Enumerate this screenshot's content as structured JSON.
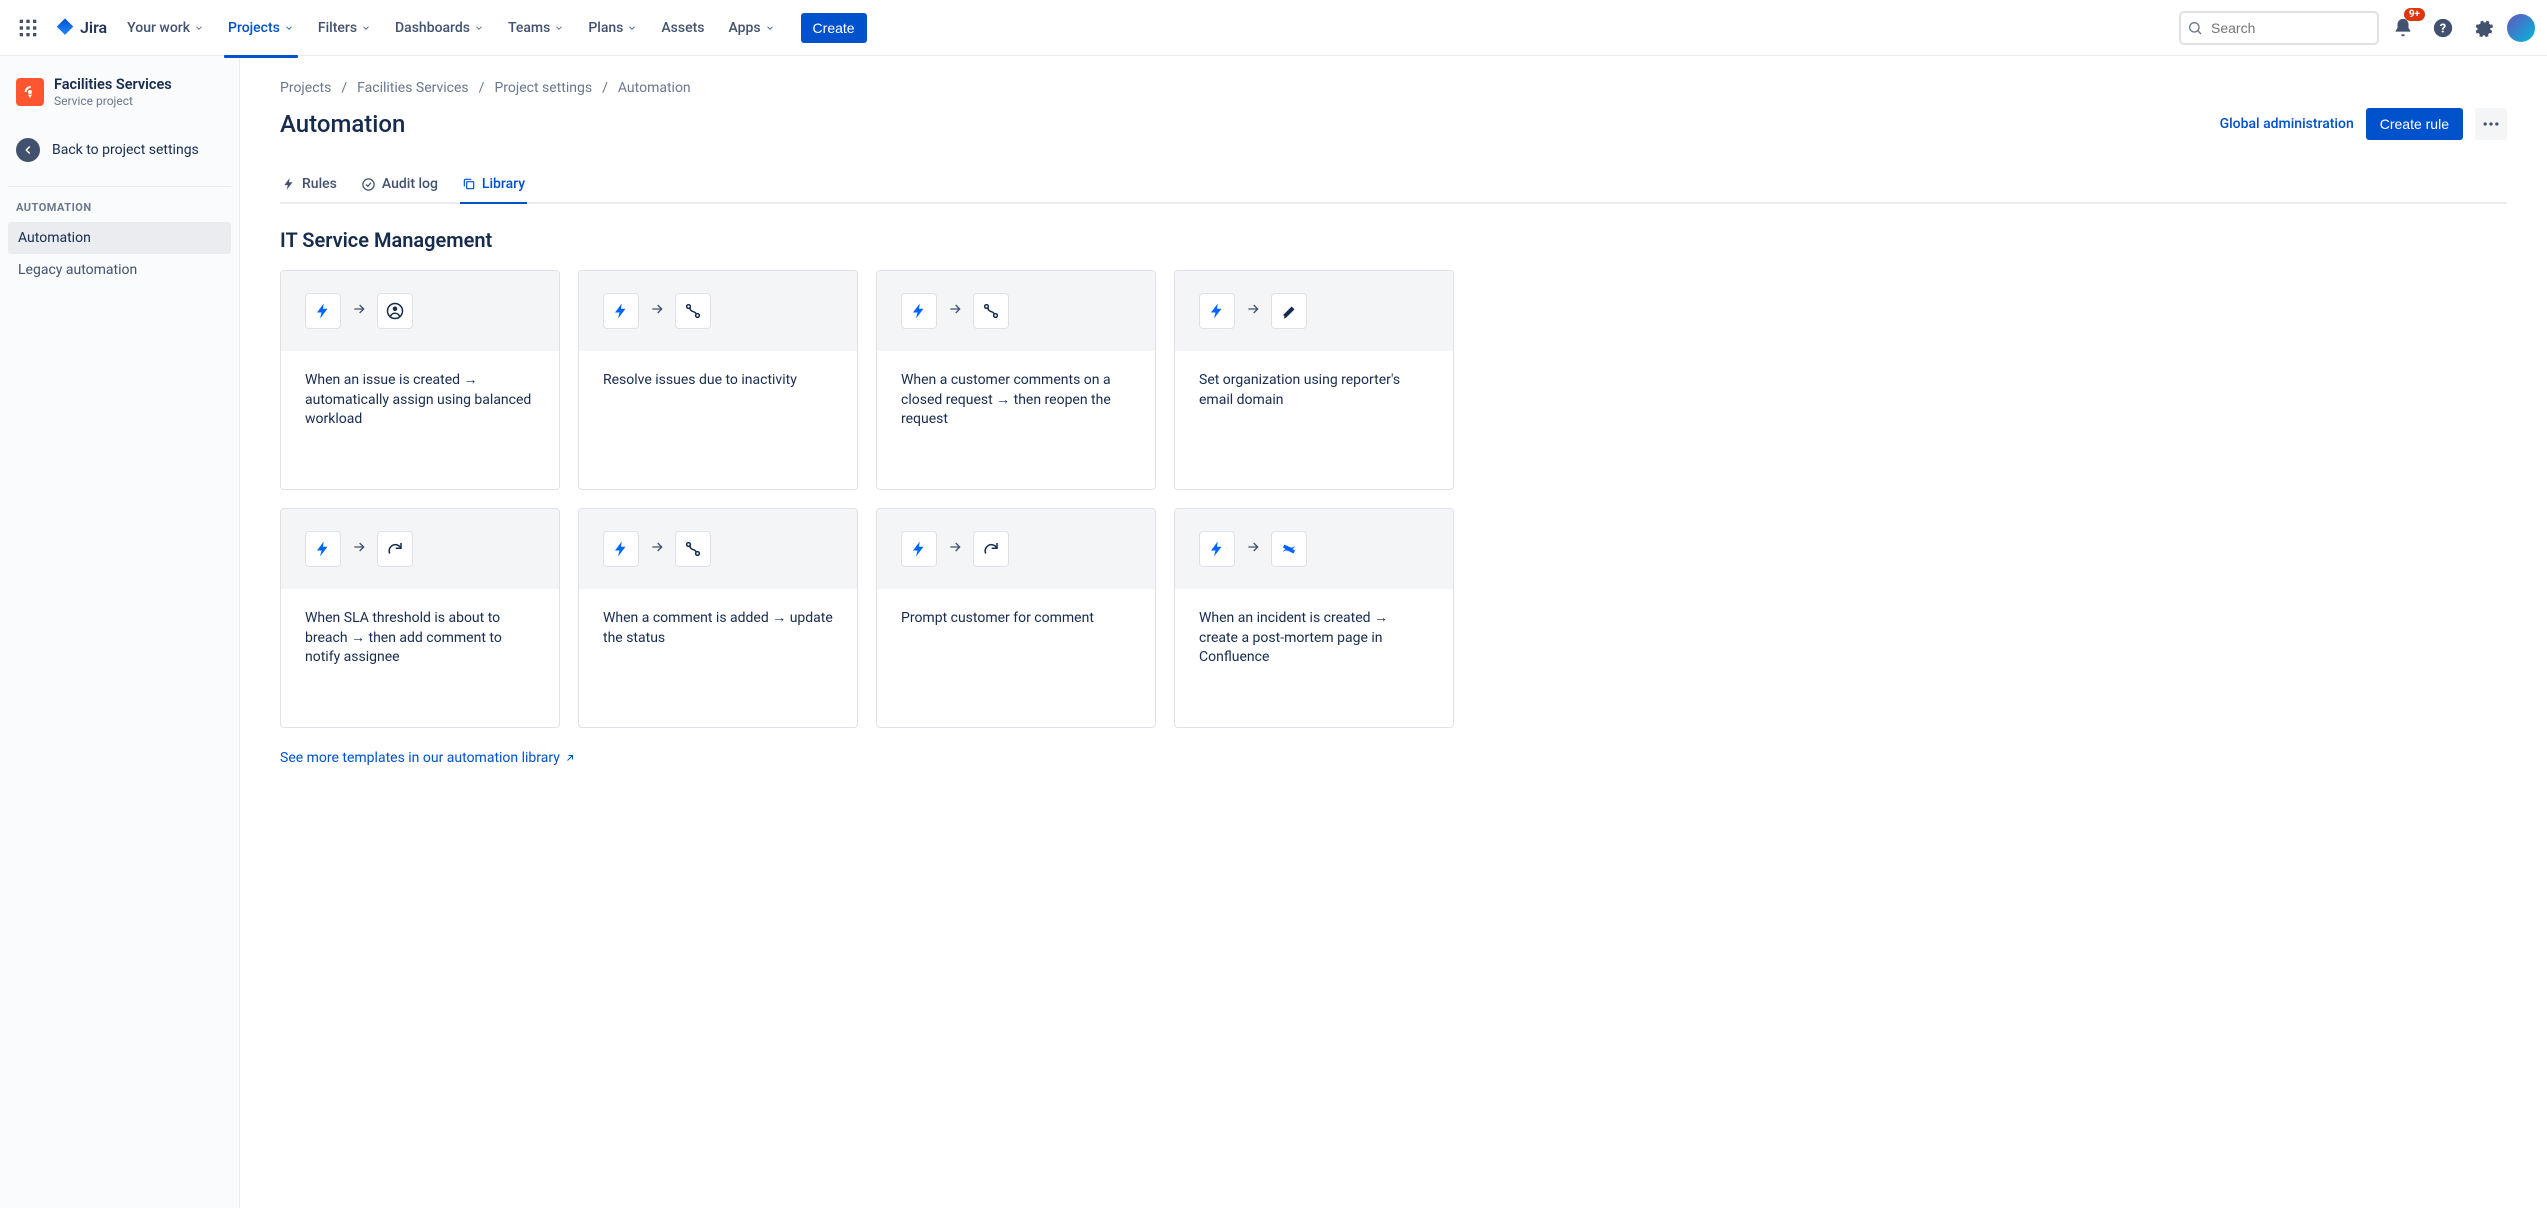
{
  "nav": {
    "brand": "Jira",
    "items": [
      "Your work",
      "Projects",
      "Filters",
      "Dashboards",
      "Teams",
      "Plans",
      "Assets",
      "Apps"
    ],
    "create": "Create",
    "search_placeholder": "Search",
    "notification_badge": "9+"
  },
  "sidebar": {
    "project_name": "Facilities Services",
    "project_type": "Service project",
    "back_label": "Back to project settings",
    "section_heading": "AUTOMATION",
    "items": [
      "Automation",
      "Legacy automation"
    ]
  },
  "breadcrumb": [
    "Projects",
    "Facilities Services",
    "Project settings",
    "Automation"
  ],
  "page": {
    "title": "Automation",
    "global_admin": "Global administration",
    "create_rule": "Create rule"
  },
  "tabs": [
    "Rules",
    "Audit log",
    "Library"
  ],
  "section_title": "IT Service Management",
  "cards": [
    {
      "desc": "When an issue is created → automatically assign using balanced workload",
      "icon": "user-circle"
    },
    {
      "desc": "Resolve issues due to inactivity",
      "icon": "branch"
    },
    {
      "desc": "When a customer comments on a closed request → then reopen the request",
      "icon": "branch"
    },
    {
      "desc": "Set organization using reporter's email domain",
      "icon": "pencil"
    },
    {
      "desc": "When SLA threshold is about to breach → then add comment to notify assignee",
      "icon": "refresh"
    },
    {
      "desc": "When a comment is added → update the status",
      "icon": "branch"
    },
    {
      "desc": "Prompt customer for comment",
      "icon": "refresh"
    },
    {
      "desc": "When an incident is created → create a post-mortem page in Confluence",
      "icon": "confluence"
    }
  ],
  "see_more": "See more templates in our automation library"
}
